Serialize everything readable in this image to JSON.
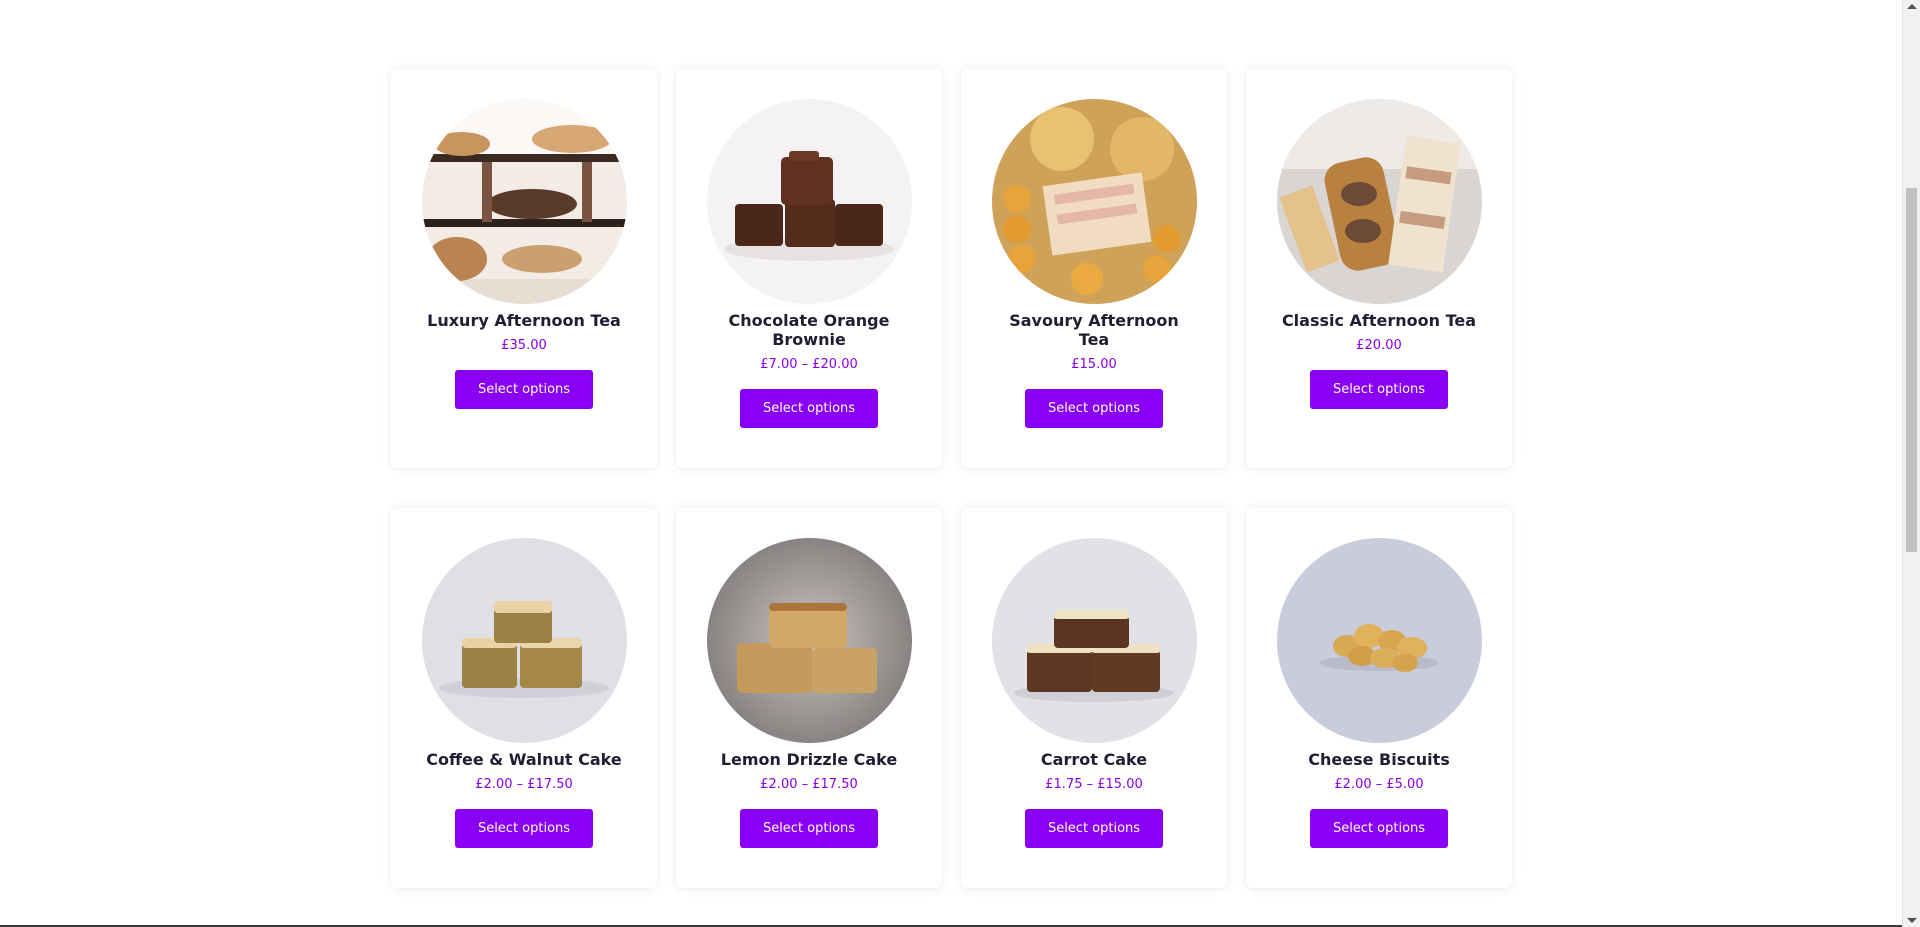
{
  "products": [
    {
      "name": "Luxury Afternoon Tea",
      "price": "£35.00",
      "button": "Select options",
      "image": "luxury-afternoon-tea-image"
    },
    {
      "name": "Chocolate Orange Brownie",
      "price": "£7.00 – £20.00",
      "button": "Select options",
      "image": "chocolate-orange-brownie-image"
    },
    {
      "name": "Savoury Afternoon Tea",
      "price": "£15.00",
      "button": "Select options",
      "image": "savoury-afternoon-tea-image"
    },
    {
      "name": "Classic Afternoon Tea",
      "price": "£20.00",
      "button": "Select options",
      "image": "classic-afternoon-tea-image"
    },
    {
      "name": "Coffee & Walnut Cake",
      "price": "£2.00 – £17.50",
      "button": "Select options",
      "image": "coffee-walnut-cake-image"
    },
    {
      "name": "Lemon Drizzle Cake",
      "price": "£2.00 – £17.50",
      "button": "Select options",
      "image": "lemon-drizzle-cake-image"
    },
    {
      "name": "Carrot Cake",
      "price": "£1.75 – £15.00",
      "button": "Select options",
      "image": "carrot-cake-image"
    },
    {
      "name": "Cheese Biscuits",
      "price": "£2.00 – £5.00",
      "button": "Select options",
      "image": "cheese-biscuits-image"
    }
  ],
  "colors": {
    "accent": "#8a00f5",
    "price": "#8a00ee",
    "title": "#1f1f33",
    "background": "#ffffff"
  }
}
